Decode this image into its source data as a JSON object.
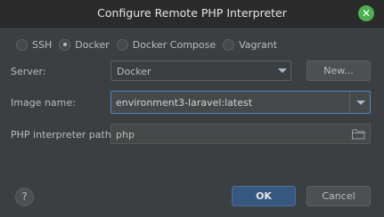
{
  "dialog": {
    "title": "Configure Remote PHP Interpreter",
    "close_icon": "close-icon",
    "accent_color": "#4caf50"
  },
  "connection_types": [
    {
      "label": "SSH",
      "selected": false
    },
    {
      "label": "Docker",
      "selected": true
    },
    {
      "label": "Docker Compose",
      "selected": false
    },
    {
      "label": "Vagrant",
      "selected": false
    }
  ],
  "server": {
    "label": "Server:",
    "value": "Docker",
    "new_button": "New..."
  },
  "image": {
    "label": "Image name:",
    "value": "environment3-laravel:latest"
  },
  "interpreter": {
    "label": "PHP interpreter path:",
    "value": "php",
    "browse_icon": "folder-icon"
  },
  "footer": {
    "help_label": "?",
    "ok_label": "OK",
    "cancel_label": "Cancel",
    "ok_color": "#365880"
  }
}
